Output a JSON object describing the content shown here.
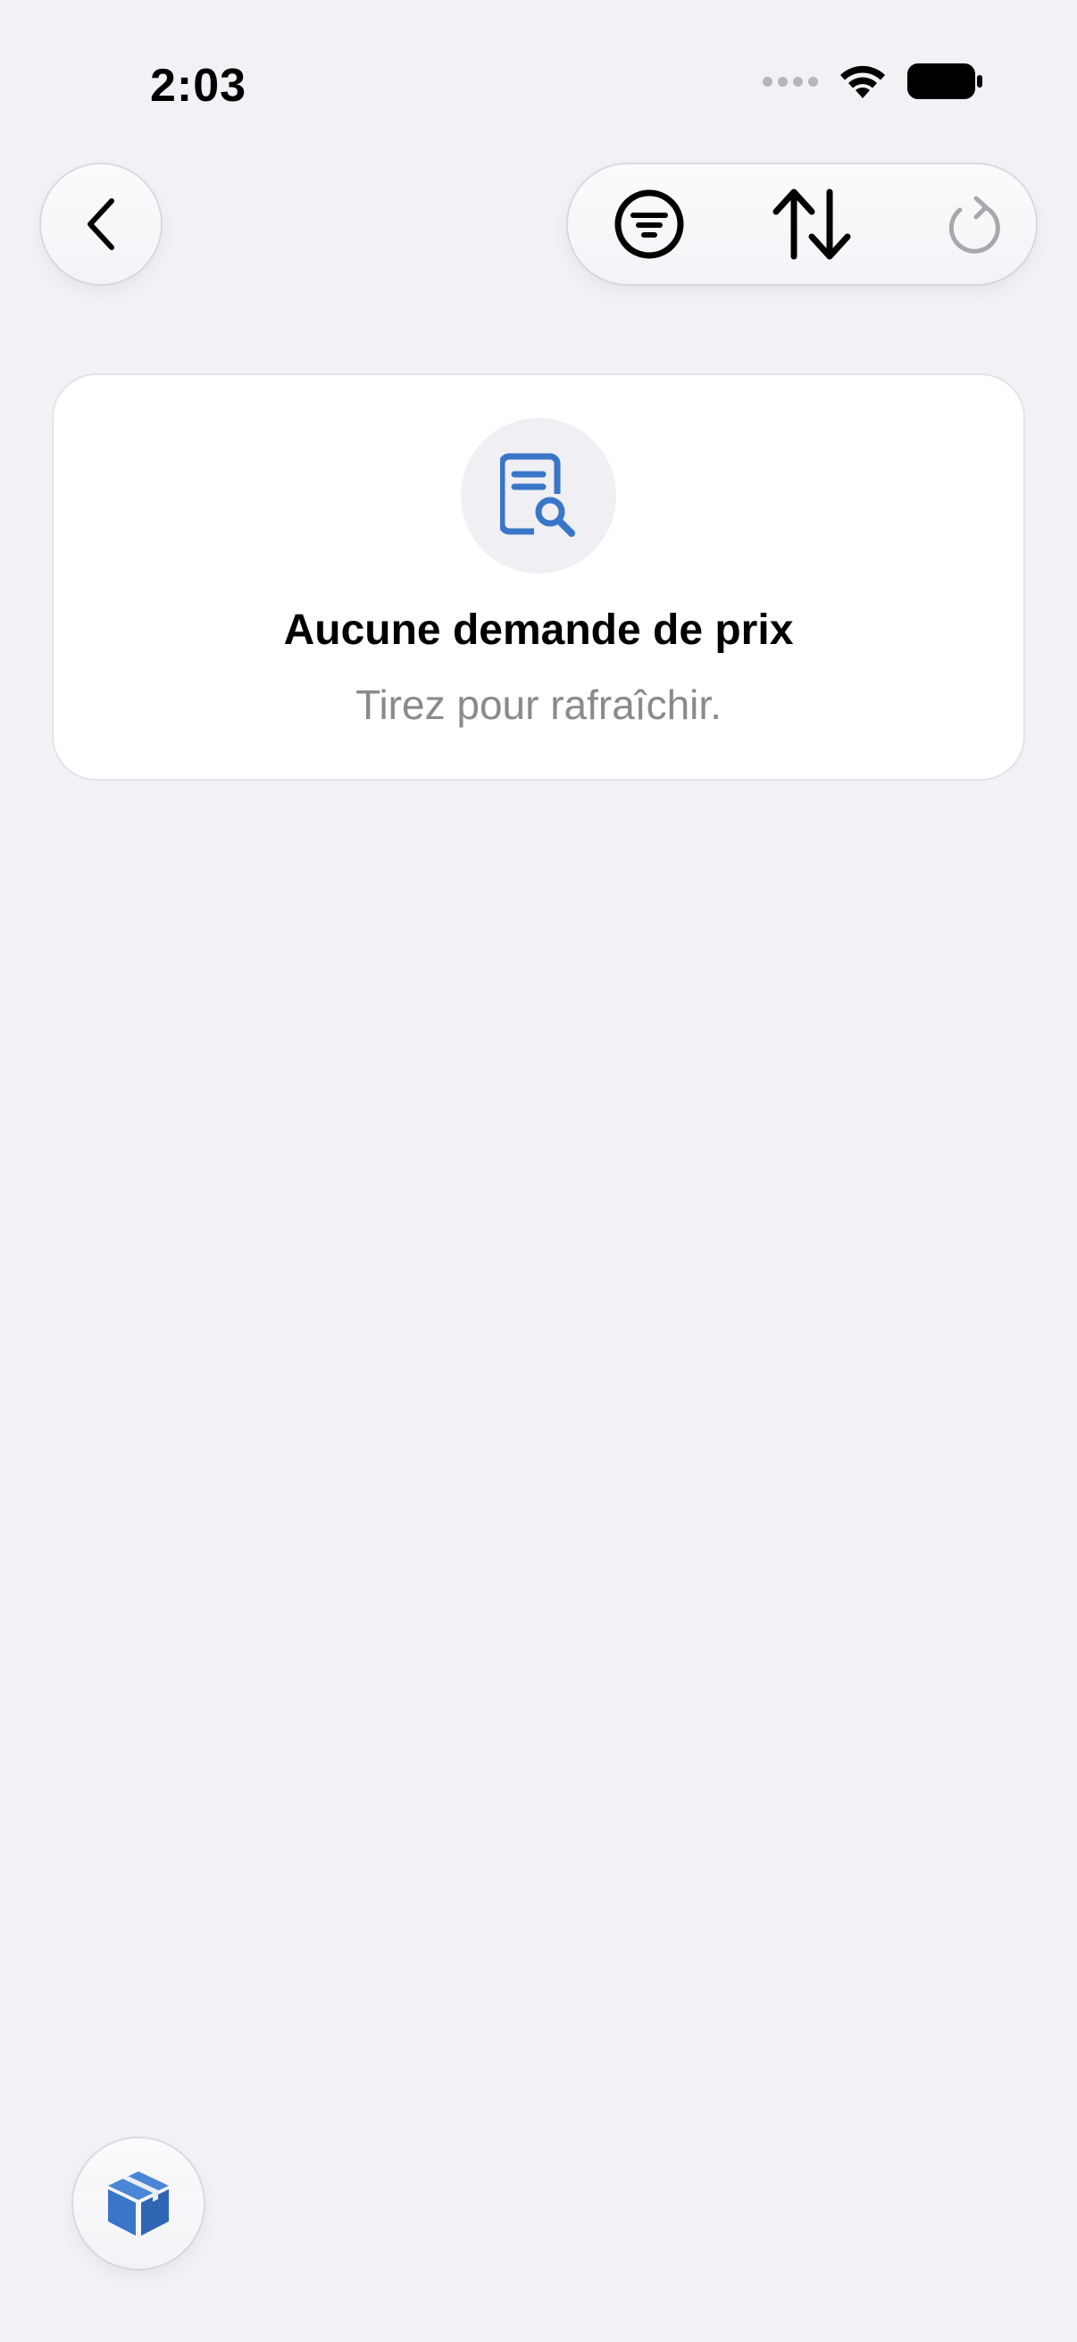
{
  "status_bar": {
    "time": "2:03",
    "icons": [
      "signal-dots-icon",
      "wifi-icon",
      "battery-icon"
    ]
  },
  "navigation": {
    "back_icon": "chevron-left-icon",
    "toolbar_icons": [
      "filter-icon",
      "sort-arrows-icon",
      "refresh-icon"
    ]
  },
  "empty_state": {
    "icon": "document-search-icon",
    "title": "Aucune demande de prix",
    "subtitle": "Tirez pour rafraîchir."
  },
  "fab": {
    "icon": "package-box-icon"
  },
  "colors": {
    "background": "#f1f1f6",
    "card": "#ffffff",
    "accent_blue": "#3a76c8",
    "subtitle_gray": "#8a8a8e",
    "disabled_gray": "#a8a8ac"
  }
}
